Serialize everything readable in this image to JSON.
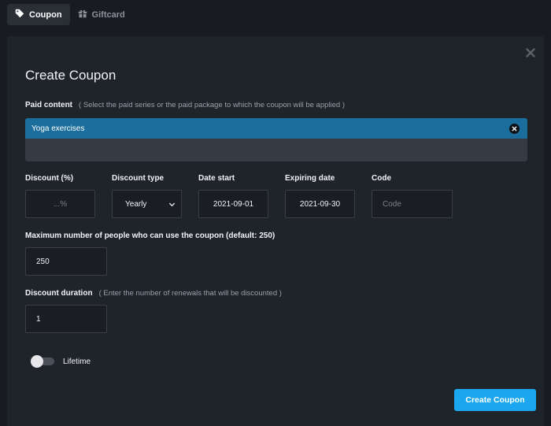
{
  "tabs": [
    {
      "label": "Coupon",
      "icon": "tag-icon",
      "active": true
    },
    {
      "label": "Giftcard",
      "icon": "gift-icon",
      "active": false
    }
  ],
  "modal": {
    "title": "Create Coupon",
    "close_icon": "close-icon"
  },
  "paid_content": {
    "label": "Paid content",
    "hint": "( Select the paid series or the paid package to which the coupon will be applied )",
    "selected": "Yoga exercises"
  },
  "discount": {
    "label": "Discount (%)",
    "placeholder": "...%",
    "value": ""
  },
  "discount_type": {
    "label": "Discount type",
    "value": "Yearly"
  },
  "date_start": {
    "label": "Date start",
    "value": "2021-09-01"
  },
  "expiring_date": {
    "label": "Expiring date",
    "value": "2021-09-30"
  },
  "code": {
    "label": "Code",
    "placeholder": "Code",
    "value": ""
  },
  "max_people": {
    "label": "Maximum number of people who can use the coupon (default: 250)",
    "value": "250"
  },
  "discount_duration": {
    "label": "Discount duration",
    "hint": "( Enter the number of renewals that will be discounted )",
    "value": "1"
  },
  "lifetime": {
    "label": "Lifetime",
    "enabled": false
  },
  "submit_label": "Create Coupon",
  "colors": {
    "accent": "#1aa7f0",
    "chip": "#1b6e9b",
    "background": "#181b21",
    "panel": "#1f232a"
  }
}
